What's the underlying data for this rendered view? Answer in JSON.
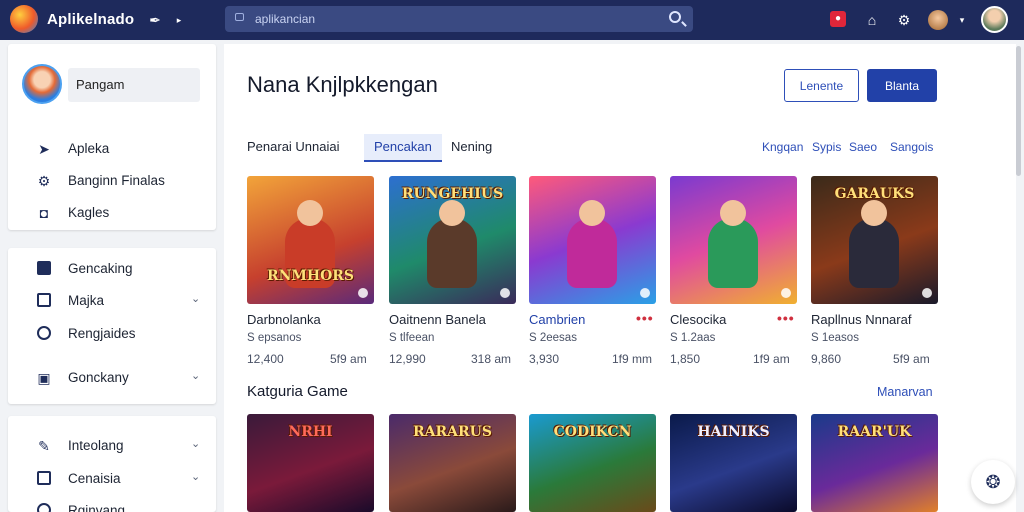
{
  "header": {
    "app_title": "Aplikelnado",
    "search_placeholder": "aplikancian"
  },
  "sidebar": {
    "profile_name": "Pangam",
    "group1": [
      {
        "label": "Apleka",
        "icon": "rocket-icon"
      },
      {
        "label": "Banginn Finalas",
        "icon": "gear-icon"
      },
      {
        "label": "Kagles",
        "icon": "bag-icon"
      }
    ],
    "group2": [
      {
        "label": "Gencaking",
        "icon": "calendar-icon"
      },
      {
        "label": "Majka",
        "icon": "list-icon"
      },
      {
        "label": "Rengjaides",
        "icon": "help-icon"
      },
      {
        "label": "Gonckany",
        "icon": "gamepad-icon"
      }
    ],
    "group3": [
      {
        "label": "Inteolang",
        "icon": "pen-icon"
      },
      {
        "label": "Cenaisia",
        "icon": "document-icon"
      },
      {
        "label": "Rgjnvang",
        "icon": "help-icon"
      }
    ]
  },
  "main": {
    "page_title": "Nana Knjlpkkengan",
    "button_secondary": "Lenente",
    "button_primary": "Blanta",
    "tabs": [
      "Penarai Unnaiai",
      "Pencakan",
      "Nening"
    ],
    "filters": [
      "Kngqan",
      "Sypis",
      "Saeo",
      "Sangois"
    ],
    "games": [
      {
        "title": "RNMHORS",
        "name": "Darbnolanka",
        "sub": "S epsanos",
        "count": "12,400",
        "size": "5f9 am"
      },
      {
        "title": "RUNGEHIUS",
        "name": "Oaitnenn Banela",
        "sub": "S tlfeean",
        "count": "12,990",
        "size": "318 am"
      },
      {
        "title": "",
        "name": "Cambrien",
        "sub": "S 2eesas",
        "count": "3,930",
        "size": "1f9 mm"
      },
      {
        "title": "",
        "name": "Clesocika",
        "sub": "S 1.2aas",
        "count": "1,850",
        "size": "1f9 am"
      },
      {
        "title": "GARAUKS",
        "name": "Rapllnus Nnnaraf",
        "sub": "S 1easos",
        "count": "9,860",
        "size": "5f9 am"
      }
    ],
    "section_title": "Katguria Game",
    "section_link": "Manarvan",
    "category_tiles": [
      "NRHI",
      "RARARUS",
      "CODIKCN",
      "HAINIKS",
      "RAAR'UK"
    ]
  },
  "colors": {
    "topbar": "#1e2a5c",
    "accent": "#2241a8",
    "link": "#2e4fb8",
    "danger": "#d0303f"
  }
}
